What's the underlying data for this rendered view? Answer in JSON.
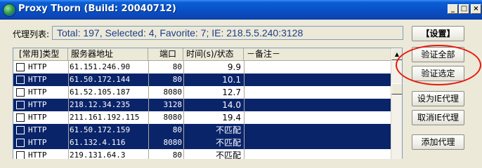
{
  "window": {
    "title": "Proxy Thorn (Build: 20040712)",
    "caption_buttons": [
      "_",
      "□",
      "×"
    ]
  },
  "summary": {
    "label": "代理列表:",
    "text": "Total: 197, Selected: 4, Favorite: 7;  IE: 218.5.5.240:3128"
  },
  "list": {
    "columns": [
      "[常用]类型",
      "服务器地址",
      "端口",
      "时间(s)/状态",
      "－备注－"
    ],
    "rows": [
      {
        "type": "HTTP",
        "ip": "61.151.246.90",
        "port": "80",
        "time": "9.9",
        "selected": false
      },
      {
        "type": "HTTP",
        "ip": "61.50.172.144",
        "port": "80",
        "time": "10.1",
        "selected": true
      },
      {
        "type": "HTTP",
        "ip": "61.52.105.187",
        "port": "8080",
        "time": "12.7",
        "selected": false
      },
      {
        "type": "HTTP",
        "ip": "218.12.34.235",
        "port": "3128",
        "time": "14.0",
        "selected": true
      },
      {
        "type": "HTTP",
        "ip": "211.161.192.115",
        "port": "8080",
        "time": "19.4",
        "selected": false
      },
      {
        "type": "HTTP",
        "ip": "61.50.172.159",
        "port": "80",
        "time": "不匹配",
        "selected": true
      },
      {
        "type": "HTTP",
        "ip": "61.132.4.116",
        "port": "8080",
        "time": "不匹配",
        "selected": true
      },
      {
        "type": "HTTP",
        "ip": "219.131.64.3",
        "port": "80",
        "time": "不匹配",
        "selected": false
      }
    ]
  },
  "buttons": {
    "settings": "【设置】",
    "verify_all": "验证全部",
    "verify_selected": "验证选定",
    "set_ie_proxy": "设为IE代理",
    "cancel_ie_proxy": "取消IE代理",
    "add_proxy": "添加代理"
  },
  "colors": {
    "selection": "#0a246a",
    "highlight": "#e8160c",
    "summary_text": "#1a3d8a"
  }
}
